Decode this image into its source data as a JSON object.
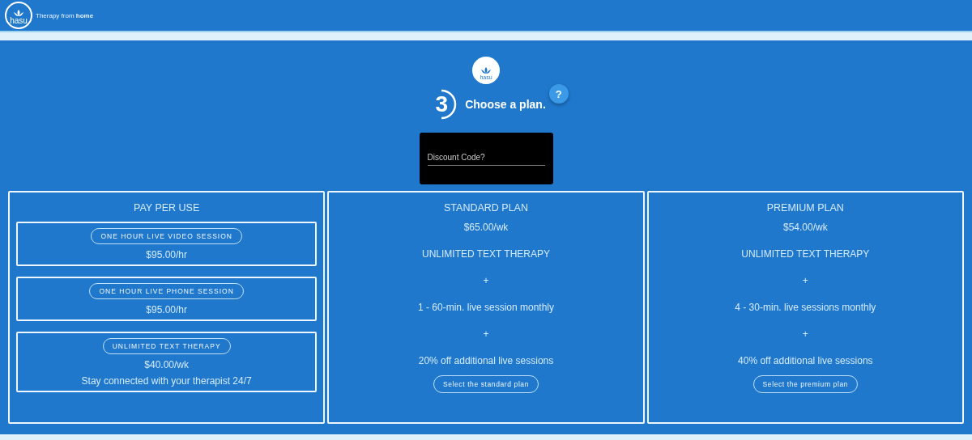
{
  "header": {
    "logo_text": "hasu",
    "tagline": "Therapy from **home**"
  },
  "step": {
    "logo_text": "hasu",
    "number": "3",
    "title": "Choose a plan.",
    "help": "?"
  },
  "discount": {
    "placeholder": "Discount Code?"
  },
  "pay_per_use": {
    "title": "PAY PER USE",
    "items": [
      {
        "label": "ONE HOUR LIVE VIDEO SESSION",
        "price": "$95.00/hr"
      },
      {
        "label": "ONE HOUR LIVE PHONE SESSION",
        "price": "$95.00/hr"
      },
      {
        "label": "UNLIMITED TEXT THERAPY",
        "price": "$40.00/wk",
        "note": "Stay connected with your therapist 24/7"
      }
    ]
  },
  "plans": [
    {
      "title": "STANDARD PLAN",
      "price": "$65.00/wk",
      "lines": [
        "UNLIMITED TEXT THERAPY",
        "+",
        "1 - 60-min. live session monthly",
        "+",
        "20% off additional live sessions"
      ],
      "button": "Select the standard plan"
    },
    {
      "title": "PREMIUM PLAN",
      "price": "$54.00/wk",
      "lines": [
        "UNLIMITED TEXT THERAPY",
        "+",
        "4 - 30-min. live sessions monthly",
        "+",
        "40% off additional live sessions"
      ],
      "button": "Select the premium plan"
    }
  ]
}
